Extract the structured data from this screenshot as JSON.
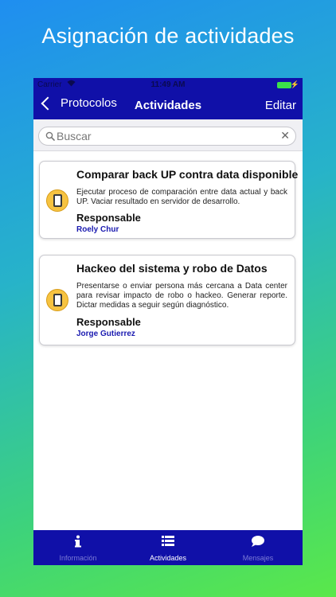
{
  "promo": {
    "title": "Asignación de actividades"
  },
  "statusbar": {
    "carrier": "Carrier",
    "time": "11:49 AM"
  },
  "navbar": {
    "back_label": "Protocolos",
    "title": "Actividades",
    "edit_label": "Editar"
  },
  "search": {
    "placeholder": "Buscar",
    "value": ""
  },
  "activities": [
    {
      "title": "Comparar back UP contra data disponible",
      "description": "Ejecutar proceso de comparación entre data actual y back UP. Vaciar resultado en servidor de desarrollo.",
      "responsible_label": "Responsable",
      "responsible_name": "Roely Chur",
      "icon": "tablet-icon"
    },
    {
      "title": "Hackeo del sistema y robo de Datos",
      "description": "Presentarse o enviar persona más cercana a Data center para revisar impacto de robo o hackeo. Generar reporte. Dictar medidas a seguir según diagnóstico.",
      "responsible_label": "Responsable",
      "responsible_name": "Jorge Gutierrez",
      "icon": "tablet-icon"
    }
  ],
  "tabs": [
    {
      "label": "Información",
      "icon": "info-icon",
      "active": false
    },
    {
      "label": "Actividades",
      "icon": "list-icon",
      "active": true
    },
    {
      "label": "Mensajes",
      "icon": "chat-bubble-icon",
      "active": false
    }
  ],
  "colors": {
    "nav_background": "#1010a8",
    "responsible_name": "#1a1ab0",
    "icon_circle": "#f6c341",
    "battery": "#3be04a"
  }
}
